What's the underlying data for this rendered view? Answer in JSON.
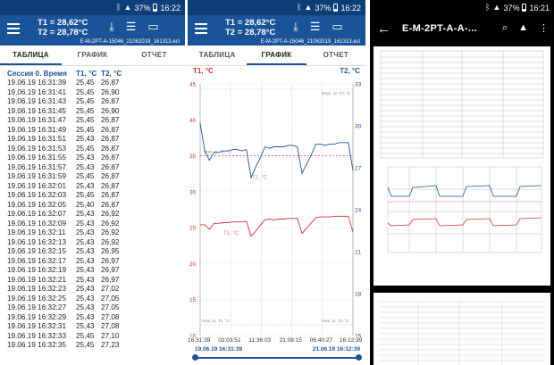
{
  "status": {
    "battery": "37%",
    "time1": "16:22",
    "time2": "16:22",
    "time3": "16:21"
  },
  "header": {
    "t1_label": "T1 = 28,62°C",
    "t2_label": "T2 = 28,78°C",
    "filename": "E-M-2PT-A-15046_21062019_161313.ecl"
  },
  "tabs": [
    "ТАБЛИЦА",
    "ГРАФИК",
    "ОТЧЕТ"
  ],
  "table": {
    "columns": [
      "Сессия 0. Время",
      "T1, °C",
      "T2, °C"
    ],
    "rows": [
      [
        "19.06.19 16:31:39",
        "25,45",
        "26,87"
      ],
      [
        "19.06.19 16:31:41",
        "25,45",
        "26,90"
      ],
      [
        "19.06.19 16:31:43",
        "25,45",
        "26,87"
      ],
      [
        "19.06.19 16:31:45",
        "25,45",
        "26,90"
      ],
      [
        "19.06.19 16:31:47",
        "25,45",
        "26,87"
      ],
      [
        "19.06.19 16:31:49",
        "25,45",
        "26,87"
      ],
      [
        "19.06.19 16:31:51",
        "25,43",
        "26,87"
      ],
      [
        "19.06.19 16:31:53",
        "25,45",
        "26,87"
      ],
      [
        "19.06.19 16:31:55",
        "25,43",
        "26,87"
      ],
      [
        "19.06.19 16:31:57",
        "25,43",
        "26,87"
      ],
      [
        "19.06.19 16:31:59",
        "25,45",
        "26,87"
      ],
      [
        "19.06.19 16:32:01",
        "25,43",
        "26,87"
      ],
      [
        "19.06.19 16:32:03",
        "25,45",
        "26,87"
      ],
      [
        "19.06.19 16:32:05",
        "25,40",
        "26,87"
      ],
      [
        "19.06.19 16:32:07",
        "25,43",
        "26,92"
      ],
      [
        "19.06.19 16:32:09",
        "25,43",
        "26,92"
      ],
      [
        "19.06.19 16:32:11",
        "25,43",
        "26,92"
      ],
      [
        "19.06.19 16:32:13",
        "25,43",
        "26,92"
      ],
      [
        "19.06.19 16:32:15",
        "25,43",
        "26,95"
      ],
      [
        "19.06.19 16:32:17",
        "25,43",
        "26,97"
      ],
      [
        "19.06.19 16:32:19",
        "25,43",
        "26,97"
      ],
      [
        "19.06.19 16:32:21",
        "25,43",
        "26,97"
      ],
      [
        "19.06.19 16:32:23",
        "25,43",
        "27,02"
      ],
      [
        "19.06.19 16:32:25",
        "25,43",
        "27,05"
      ],
      [
        "19.06.19 16:32:27",
        "25,43",
        "27,05"
      ],
      [
        "19.06.19 16:32:29",
        "25,43",
        "27,08"
      ],
      [
        "19.06.19 16:32:31",
        "25,43",
        "27,08"
      ],
      [
        "19.06.19 16:32:33",
        "25,45",
        "27,10"
      ],
      [
        "19.06.19 16:32:35",
        "25,45",
        "27,23"
      ]
    ]
  },
  "chart_data": {
    "type": "line",
    "title": "",
    "ylabel_left": "T1, °C",
    "ylabel_right": "T2, °C",
    "left_ticks": [
      "45",
      "40",
      "35",
      "30",
      "25",
      "20",
      "15",
      "10"
    ],
    "right_ticks": [
      "33",
      "30",
      "27",
      "24",
      "21",
      "18",
      "15"
    ],
    "left_ylim": [
      10,
      45
    ],
    "right_ylim": [
      15,
      33
    ],
    "x_ticks": [
      "16:31:39",
      "02:03:51",
      "11:36:03",
      "21:08:15",
      "06:40:27",
      "16:12:39"
    ],
    "date_start": "19.06.19 16:31:39",
    "date_end": "21.06.19 16:12:39",
    "annotations": {
      "top": "Верх. гр. T2, °C",
      "mid": "Ниж. гр. T1, °C",
      "bottom_left": "Ниж. гр. T1, °C",
      "bottom_right": "Ниж. гр. T2, °C",
      "t1_tag": "T1, °C",
      "t2_tag": "T2, °C"
    },
    "series": [
      {
        "name": "T1, °C",
        "color": "#d32f2f",
        "values": [
          25.4,
          25.4,
          25.5,
          25.6,
          25.6,
          25.7,
          25.7,
          25.8,
          25.8,
          25.8,
          25.9,
          26.0,
          26.0,
          26.1,
          26.1,
          26.2,
          26.1,
          26.2,
          26.2,
          26.3,
          26.3,
          26.3,
          26.4,
          26.4,
          26.4,
          26.4,
          26.5,
          26.5,
          26.5,
          26.6,
          26.6,
          26.6,
          26.6,
          26.6
        ]
      },
      {
        "name": "T2, °C",
        "color": "#1b5399",
        "values": [
          30.2,
          28.2,
          28.2,
          28.1,
          28.1,
          28.2,
          28.2,
          28.3,
          28.3,
          28.2,
          28.3,
          28.3,
          28.4,
          28.4,
          28.5,
          28.4,
          28.5,
          28.5,
          28.5,
          28.6,
          28.6,
          28.5,
          28.6,
          28.6,
          28.6,
          28.7,
          28.7,
          28.6,
          28.7,
          28.7,
          28.8,
          28.8,
          28.8,
          28.8
        ]
      }
    ]
  },
  "pdf": {
    "title": "E-M-2PT-A-A-..."
  }
}
